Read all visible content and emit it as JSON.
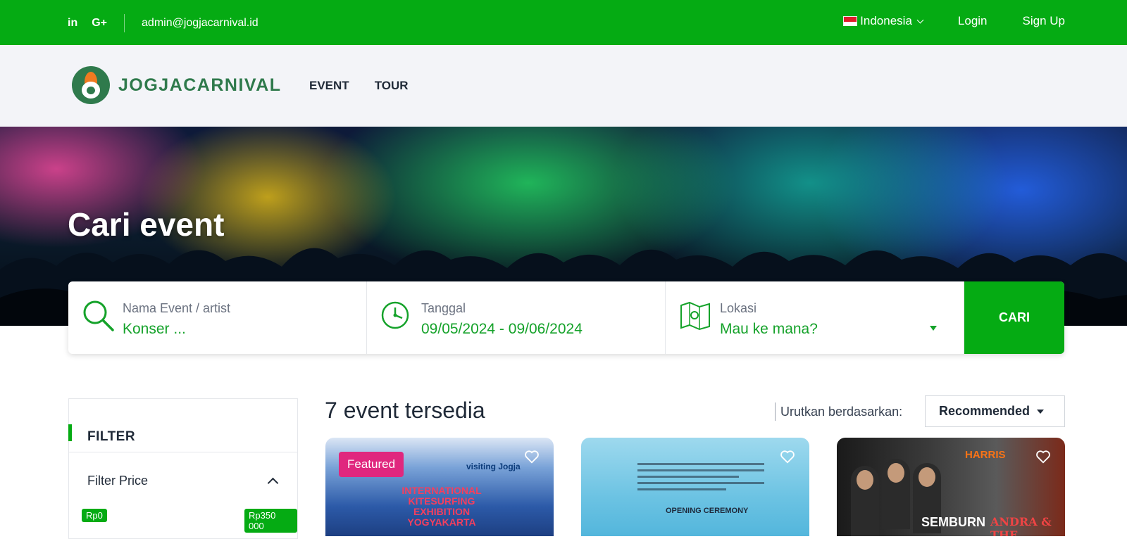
{
  "topbar": {
    "social": [
      "in",
      "G+"
    ],
    "email": "admin@jogjacarnival.id",
    "language": "Indonesia",
    "login": "Login",
    "signup": "Sign Up"
  },
  "nav": {
    "brand": "JOGJACARNIVAL",
    "links": [
      "EVENT",
      "TOUR"
    ]
  },
  "hero": {
    "title": "Cari event"
  },
  "search": {
    "event_label": "Nama Event / artist",
    "event_placeholder": "Konser ...",
    "date_label": "Tanggal",
    "date_value": "09/05/2024 - 09/06/2024",
    "location_label": "Lokasi",
    "location_value": "Mau ke mana?",
    "button": "CARI"
  },
  "filter": {
    "title": "FILTER",
    "price_title": "Filter Price",
    "min": "Rp0",
    "max": "Rp350 000"
  },
  "results": {
    "count_text": "7 event tersedia",
    "sort_label": "Urutkan berdasarkan:",
    "sort_value": "Recommended"
  },
  "cards": [
    {
      "badge": "Featured",
      "poster_text": "INTERNATIONAL KITESURFING EXHIBITION YOGYAKARTA",
      "poster_tag": "visiting Jogja"
    },
    {
      "poster_text": "OPENING CEREMONY"
    },
    {
      "poster_brand": "HARRIS",
      "poster_text": "SEMBURN",
      "poster_text2": "ANDRA & THE BACKBONE"
    }
  ],
  "colors": {
    "primary": "#05ab13",
    "featured": "#e0277e"
  }
}
